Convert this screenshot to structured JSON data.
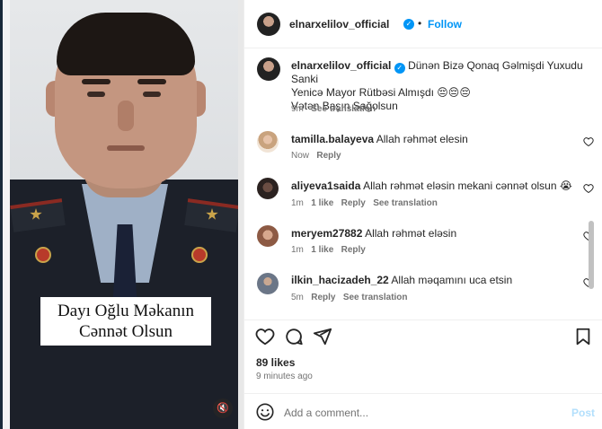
{
  "media": {
    "caption_line1": "Dayı Oğlu Məkanın",
    "caption_line2": "Cənnət Olsun",
    "mute_icon": "speaker-muted-icon"
  },
  "header": {
    "username": "elnarxelilov_official",
    "separator": "•",
    "follow_label": "Follow",
    "more_icon": "..."
  },
  "post": {
    "username": "elnarxelilov_official",
    "text_line1": "Dünən Bizə Qonaq Gəlmişdi Yuxudu Sanki",
    "text_line2": "Yenicə Mayor Rütbəsi Almışdı 😔😔😔",
    "text_line3": "Vətən Başın Sağolsun",
    "time": "9m",
    "see_translation": "See translation"
  },
  "comments": [
    {
      "username": "tamilla.balayeva",
      "text": "Allah rəhmət elesin",
      "time": "Now",
      "likes": "",
      "reply": "Reply",
      "translation": ""
    },
    {
      "username": "aliyeva1saida",
      "text": "Allah rəhmət eləsin mekani cənnət olsun 😭",
      "time": "1m",
      "likes": "1 like",
      "reply": "Reply",
      "translation": "See translation"
    },
    {
      "username": "meryem27882",
      "text": "Allah rəhmət eləsin",
      "time": "1m",
      "likes": "1 like",
      "reply": "Reply",
      "translation": ""
    },
    {
      "username": "ilkin_hacizadeh_22",
      "text": "Allah məqamını uca etsin",
      "time": "5m",
      "likes": "",
      "reply": "Reply",
      "translation": "See translation"
    }
  ],
  "actions": {
    "likes": "89 likes",
    "time_ago": "9 minutes ago"
  },
  "comment_box": {
    "placeholder": "Add a comment...",
    "post_label": "Post"
  },
  "colors": {
    "accent": "#0095f6",
    "text": "#262626",
    "secondary": "#737373"
  }
}
